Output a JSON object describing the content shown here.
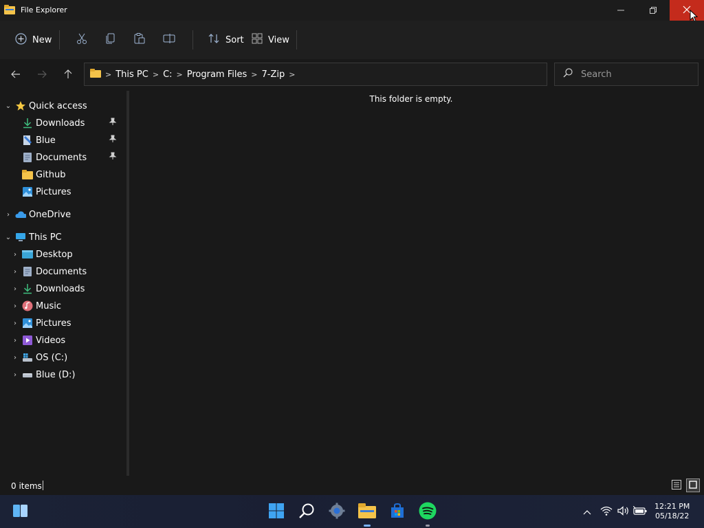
{
  "window": {
    "title": "File Explorer"
  },
  "toolbar": {
    "new_label": "New",
    "sort_label": "Sort",
    "view_label": "View"
  },
  "address": {
    "crumbs": [
      "This PC",
      "C:",
      "Program Files",
      "7-Zip"
    ]
  },
  "search": {
    "placeholder": "Search"
  },
  "nav_pane": {
    "quick_access": {
      "label": "Quick access",
      "items": [
        {
          "label": "Downloads",
          "icon": "download-icon",
          "pinned": true
        },
        {
          "label": "Blue",
          "icon": "document-icon",
          "pinned": true
        },
        {
          "label": "Documents",
          "icon": "documents-icon",
          "pinned": true
        },
        {
          "label": "Github",
          "icon": "folder-icon",
          "pinned": false
        },
        {
          "label": "Pictures",
          "icon": "pictures-icon",
          "pinned": false
        }
      ]
    },
    "onedrive": {
      "label": "OneDrive"
    },
    "this_pc": {
      "label": "This PC",
      "items": [
        {
          "label": "Desktop",
          "icon": "desktop-icon"
        },
        {
          "label": "Documents",
          "icon": "documents-icon"
        },
        {
          "label": "Downloads",
          "icon": "download-icon"
        },
        {
          "label": "Music",
          "icon": "music-icon"
        },
        {
          "label": "Pictures",
          "icon": "pictures-icon"
        },
        {
          "label": "Videos",
          "icon": "videos-icon"
        },
        {
          "label": "OS (C:)",
          "icon": "drive-c-icon"
        },
        {
          "label": "Blue (D:)",
          "icon": "drive-d-icon"
        }
      ]
    }
  },
  "content": {
    "empty_message": "This folder is empty."
  },
  "status": {
    "item_count": "0 items"
  },
  "taskbar": {
    "time": "12:21 PM",
    "date": "05/18/22"
  },
  "colors": {
    "accent": "#60cdff",
    "close_hover": "#c42b1c",
    "folder": "#f4c34a"
  }
}
